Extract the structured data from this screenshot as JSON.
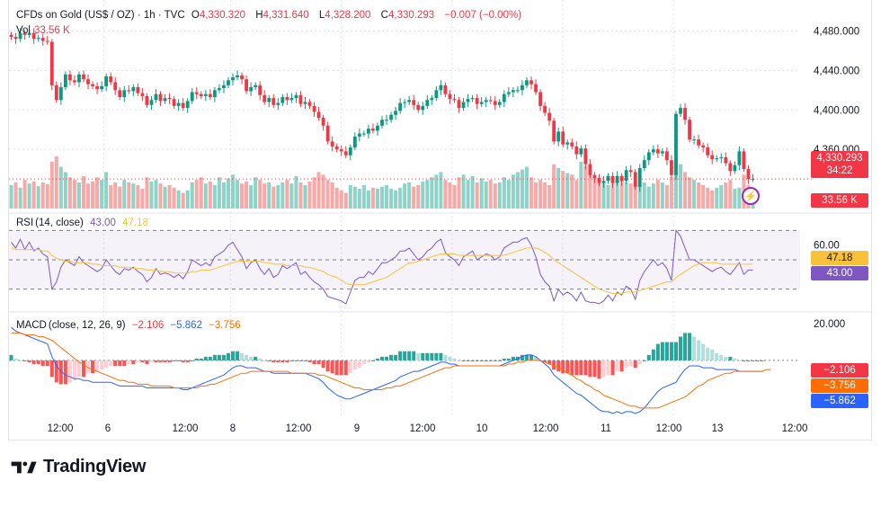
{
  "header": {
    "symbol": "CFDs on Gold (US$ / OZ) · 1h · TVC",
    "o_label": "O",
    "o_value": "4,330.320",
    "h_label": "H",
    "h_value": "4,331.640",
    "l_label": "L",
    "l_value": "4,328.200",
    "c_label": "C",
    "c_value": "4,330.293",
    "change": "−0.007 (−0.00%)",
    "vol_label": "Vol",
    "vol_value": "33.56 K"
  },
  "rsi": {
    "label": "RSI",
    "params": "14, close",
    "value": "43.00",
    "ma_value": "47.18"
  },
  "macd": {
    "label": "MACD",
    "params": "close, 12, 26, 9",
    "hist": "−2.106",
    "macd_val": "−5.862",
    "signal": "−3.756"
  },
  "tags": {
    "price": "4,330.293",
    "countdown": "34:22",
    "volume": "33.56 K",
    "rsi_ma": "47.18",
    "rsi": "43.00",
    "macd_hist": "−2.106",
    "macd_signal": "−3.756",
    "macd_line": "−5.862"
  },
  "colors": {
    "up": "#089981",
    "down": "#f23645",
    "up_vol": "#8fd3c8",
    "down_vol": "#f7a9a7",
    "rsi": "#7e57c2",
    "rsi_ma": "#f7c23a",
    "macd": "#2962ff",
    "signal": "#ff6d00"
  },
  "watermark": "TradingView",
  "flash_icon": "lightning-icon",
  "chart_data": [
    {
      "type": "candlestick",
      "title": "CFDs on Gold (US$ / OZ) · 1h · TVC",
      "price_ticks": [
        "4,480.000",
        "4,440.000",
        "4,400.000",
        "4,360.000"
      ],
      "price_tick_values": [
        4480,
        4440,
        4400,
        4360
      ],
      "ylim": [
        4300,
        4495
      ],
      "x_labels": [
        "12:00",
        "6",
        "12:00",
        "8",
        "12:00",
        "9",
        "12:00",
        "10",
        "12:00",
        "11",
        "12:00",
        "13",
        "12:00"
      ],
      "close_path": [
        4474,
        4472,
        4478,
        4476,
        4478,
        4472,
        4473,
        4470,
        4469,
        4425,
        4410,
        4423,
        4436,
        4430,
        4428,
        4436,
        4431,
        4426,
        4424,
        4421,
        4424,
        4434,
        4428,
        4420,
        4413,
        4420,
        4419,
        4423,
        4417,
        4414,
        4405,
        4410,
        4416,
        4409,
        4412,
        4411,
        4404,
        4407,
        4402,
        4409,
        4418,
        4416,
        4414,
        4416,
        4413,
        4420,
        4422,
        4425,
        4430,
        4433,
        4435,
        4431,
        4419,
        4423,
        4425,
        4415,
        4408,
        4412,
        4405,
        4407,
        4413,
        4410,
        4412,
        4415,
        4406,
        4408,
        4404,
        4398,
        4392,
        4384,
        4368,
        4363,
        4360,
        4358,
        4354,
        4362,
        4373,
        4376,
        4376,
        4381,
        4379,
        4384,
        4390,
        4390,
        4395,
        4399,
        4407,
        4408,
        4410,
        4405,
        4400,
        4404,
        4410,
        4412,
        4420,
        4425,
        4416,
        4411,
        4410,
        4402,
        4408,
        4411,
        4412,
        4406,
        4408,
        4410,
        4409,
        4405,
        4408,
        4416,
        4418,
        4420,
        4420,
        4425,
        4430,
        4426,
        4418,
        4404,
        4397,
        4389,
        4368,
        4378,
        4365,
        4367,
        4363,
        4355,
        4361,
        4345,
        4334,
        4331,
        4326,
        4328,
        4333,
        4326,
        4333,
        4328,
        4339,
        4337,
        4322,
        4341,
        4349,
        4357,
        4360,
        4356,
        4358,
        4349,
        4334,
        4396,
        4402,
        4390,
        4370,
        4370,
        4364,
        4362,
        4354,
        4350,
        4351,
        4352,
        4346,
        4338,
        4344,
        4358,
        4340,
        4330,
        4330
      ],
      "volume_levels": [
        0.45,
        0.5,
        0.4,
        0.55,
        0.48,
        0.52,
        0.43,
        0.5,
        0.47,
        0.9,
        1.0,
        0.8,
        0.7,
        0.6,
        0.55,
        0.5,
        0.62,
        0.48,
        0.52,
        0.6,
        0.55,
        0.7,
        0.45,
        0.5,
        0.42,
        0.55,
        0.5,
        0.48,
        0.45,
        0.38,
        0.6,
        0.52,
        0.55,
        0.48,
        0.42,
        0.45,
        0.4,
        0.35,
        0.3,
        0.35,
        0.5,
        0.55,
        0.6,
        0.48,
        0.52,
        0.45,
        0.6,
        0.5,
        0.58,
        0.65,
        0.55,
        0.48,
        0.52,
        0.45,
        0.6,
        0.55,
        0.48,
        0.5,
        0.42,
        0.45,
        0.5,
        0.55,
        0.48,
        0.62,
        0.5,
        0.45,
        0.52,
        0.6,
        0.7,
        0.65,
        0.55,
        0.5,
        0.4,
        0.35,
        0.3,
        0.45,
        0.42,
        0.38,
        0.45,
        0.35,
        0.4,
        0.38,
        0.42,
        0.45,
        0.38,
        0.35,
        0.4,
        0.48,
        0.5,
        0.42,
        0.45,
        0.52,
        0.55,
        0.6,
        0.65,
        0.7,
        0.55,
        0.5,
        0.45,
        0.6,
        0.65,
        0.55,
        0.62,
        0.5,
        0.58,
        0.52,
        0.55,
        0.48,
        0.5,
        0.6,
        0.55,
        0.65,
        0.7,
        0.75,
        0.8,
        0.6,
        0.5,
        0.55,
        0.5,
        0.45,
        0.85,
        0.78,
        0.72,
        0.68,
        0.65,
        0.55,
        0.9,
        0.82,
        0.7,
        0.6,
        0.55,
        0.5,
        0.45,
        0.5,
        0.55,
        0.62,
        0.5,
        0.48,
        0.52,
        0.45,
        0.5,
        0.42,
        0.48,
        0.55,
        0.5,
        0.45,
        0.6,
        0.95,
        0.85,
        0.7,
        0.6,
        0.55,
        0.5,
        0.45,
        0.4,
        0.35,
        0.4,
        0.45,
        0.5,
        0.55,
        0.38,
        0.4,
        0.65,
        0.45,
        0.35
      ],
      "volume_last": "33.56 K"
    },
    {
      "type": "line",
      "title": "RSI",
      "y_ticks": [
        "60.00"
      ],
      "ylim": [
        20,
        80
      ],
      "band": [
        30,
        70
      ],
      "midline": 50,
      "series": [
        {
          "name": "RSI",
          "values": [
            62,
            58,
            64,
            57,
            62,
            56,
            58,
            54,
            52,
            30,
            35,
            45,
            50,
            48,
            46,
            52,
            48,
            46,
            44,
            42,
            44,
            50,
            46,
            42,
            40,
            44,
            43,
            45,
            42,
            40,
            35,
            38,
            44,
            40,
            41,
            40,
            38,
            40,
            37,
            42,
            50,
            48,
            46,
            48,
            46,
            52,
            54,
            56,
            60,
            62,
            57,
            52,
            44,
            48,
            50,
            44,
            40,
            44,
            38,
            40,
            46,
            44,
            46,
            48,
            40,
            42,
            38,
            35,
            33,
            30,
            25,
            24,
            23,
            22,
            20,
            28,
            36,
            38,
            38,
            42,
            40,
            44,
            48,
            48,
            50,
            52,
            56,
            56,
            58,
            54,
            50,
            52,
            56,
            58,
            62,
            64,
            55,
            52,
            50,
            46,
            52,
            54,
            56,
            50,
            52,
            54,
            53,
            50,
            52,
            58,
            60,
            62,
            62,
            64,
            65,
            60,
            52,
            40,
            35,
            32,
            22,
            30,
            26,
            28,
            26,
            22,
            28,
            22,
            21,
            21,
            20,
            22,
            26,
            22,
            28,
            26,
            32,
            30,
            23,
            36,
            42,
            46,
            50,
            46,
            48,
            44,
            36,
            70,
            66,
            58,
            50,
            50,
            48,
            46,
            44,
            42,
            44,
            45,
            42,
            40,
            44,
            48,
            40,
            43,
            43
          ]
        },
        {
          "name": "MA",
          "values": [
            58,
            57,
            57,
            57,
            57,
            57,
            57,
            56,
            56,
            53,
            51,
            50,
            49,
            49,
            48,
            48,
            48,
            48,
            47,
            47,
            46,
            46,
            46,
            46,
            45,
            45,
            45,
            44,
            44,
            44,
            43,
            43,
            43,
            42,
            42,
            42,
            41,
            41,
            41,
            41,
            42,
            42,
            43,
            43,
            43,
            44,
            45,
            46,
            47,
            48,
            49,
            49,
            49,
            49,
            49,
            49,
            48,
            48,
            47,
            47,
            47,
            46,
            46,
            46,
            46,
            45,
            45,
            44,
            43,
            42,
            40,
            39,
            38,
            36,
            34,
            33,
            33,
            33,
            33,
            34,
            35,
            36,
            37,
            38,
            40,
            42,
            44,
            46,
            48,
            48,
            49,
            50,
            51,
            52,
            53,
            54,
            54,
            54,
            54,
            53,
            53,
            53,
            53,
            53,
            53,
            53,
            53,
            53,
            53,
            53,
            54,
            55,
            56,
            57,
            58,
            58,
            58,
            57,
            55,
            53,
            50,
            48,
            46,
            44,
            42,
            40,
            38,
            36,
            34,
            32,
            30,
            29,
            28,
            27,
            27,
            27,
            28,
            28,
            28,
            29,
            30,
            31,
            32,
            33,
            34,
            35,
            35,
            38,
            40,
            42,
            44,
            46,
            47,
            48,
            48,
            48,
            48,
            47,
            47,
            47,
            47,
            47,
            47,
            47,
            47
          ]
        }
      ]
    },
    {
      "type": "line+histogram",
      "title": "MACD",
      "y_ticks": [
        "20.000"
      ],
      "ylim": [
        -30,
        25
      ],
      "series": [
        {
          "name": "MACD",
          "values": [
            18,
            16,
            15,
            14,
            13,
            12,
            11,
            10,
            9,
            2,
            -3,
            -6,
            -8,
            -9,
            -10,
            -10,
            -11,
            -11,
            -12,
            -12,
            -12,
            -12,
            -12,
            -13,
            -14,
            -14,
            -14,
            -14,
            -14,
            -14,
            -15,
            -15,
            -15,
            -15,
            -15,
            -15,
            -15,
            -15,
            -16,
            -16,
            -15,
            -14,
            -13,
            -12,
            -11,
            -10,
            -9,
            -8,
            -6,
            -4,
            -3,
            -3,
            -4,
            -4,
            -4,
            -5,
            -6,
            -6,
            -7,
            -7,
            -7,
            -7,
            -7,
            -7,
            -7,
            -7,
            -8,
            -9,
            -10,
            -12,
            -15,
            -17,
            -19,
            -20,
            -21,
            -21,
            -20,
            -19,
            -18,
            -17,
            -16,
            -15,
            -14,
            -13,
            -12,
            -11,
            -9,
            -8,
            -7,
            -6,
            -6,
            -5,
            -4,
            -3,
            -2,
            -1,
            -1,
            -2,
            -2,
            -3,
            -3,
            -3,
            -3,
            -3,
            -3,
            -3,
            -3,
            -3,
            -3,
            -2,
            -1,
            0,
            1,
            2,
            3,
            3,
            2,
            0,
            -2,
            -4,
            -8,
            -10,
            -12,
            -14,
            -16,
            -18,
            -19,
            -21,
            -23,
            -25,
            -27,
            -28,
            -28,
            -29,
            -28,
            -29,
            -28,
            -28,
            -29,
            -28,
            -26,
            -23,
            -20,
            -17,
            -15,
            -14,
            -13,
            -12,
            -8,
            -5,
            -3,
            -3,
            -3,
            -4,
            -4,
            -4,
            -5,
            -5,
            -5,
            -5,
            -5,
            -6,
            -6,
            -6,
            -6,
            -6,
            -6
          ]
        },
        {
          "name": "Signal",
          "values": [
            15,
            15,
            15,
            14,
            14,
            14,
            13,
            13,
            12,
            11,
            9,
            7,
            5,
            3,
            1,
            -1,
            -2,
            -4,
            -5,
            -6,
            -7,
            -8,
            -9,
            -10,
            -11,
            -11,
            -12,
            -12,
            -13,
            -13,
            -13,
            -14,
            -14,
            -14,
            -14,
            -14,
            -15,
            -15,
            -15,
            -15,
            -15,
            -15,
            -14,
            -14,
            -13,
            -13,
            -12,
            -11,
            -10,
            -9,
            -8,
            -7,
            -7,
            -6,
            -6,
            -6,
            -6,
            -6,
            -6,
            -6,
            -6,
            -6,
            -7,
            -7,
            -7,
            -7,
            -7,
            -7,
            -8,
            -8,
            -9,
            -10,
            -11,
            -12,
            -13,
            -14,
            -15,
            -15,
            -16,
            -16,
            -16,
            -16,
            -16,
            -15,
            -15,
            -14,
            -14,
            -13,
            -12,
            -11,
            -10,
            -9,
            -8,
            -7,
            -6,
            -5,
            -4,
            -4,
            -3,
            -3,
            -3,
            -3,
            -3,
            -3,
            -3,
            -3,
            -3,
            -3,
            -3,
            -3,
            -2,
            -2,
            -1,
            -1,
            0,
            0,
            0,
            0,
            -1,
            -2,
            -3,
            -4,
            -5,
            -7,
            -8,
            -10,
            -11,
            -13,
            -14,
            -16,
            -17,
            -19,
            -20,
            -21,
            -22,
            -23,
            -24,
            -25,
            -25,
            -26,
            -26,
            -26,
            -26,
            -26,
            -25,
            -24,
            -23,
            -22,
            -21,
            -20,
            -18,
            -16,
            -14,
            -13,
            -11,
            -10,
            -9,
            -8,
            -7,
            -7,
            -6,
            -6,
            -6,
            -6,
            -6,
            -6,
            -6,
            -5,
            -5
          ]
        }
      ]
    }
  ]
}
